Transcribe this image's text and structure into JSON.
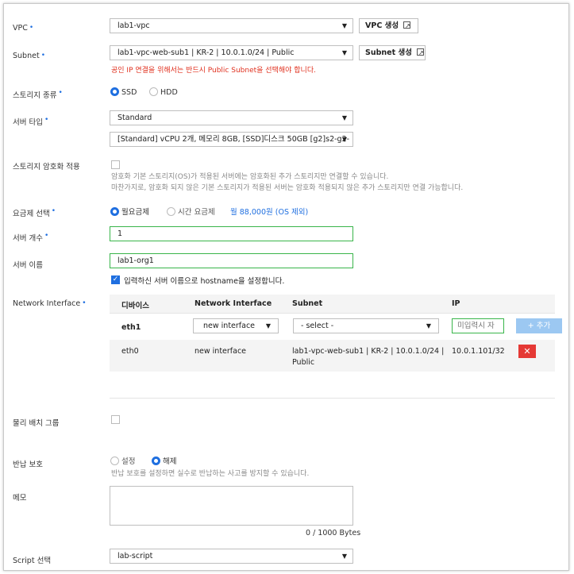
{
  "vpc": {
    "label": "VPC",
    "value": "lab1-vpc",
    "create_btn": "VPC 생성"
  },
  "subnet": {
    "label": "Subnet",
    "value": "lab1-vpc-web-sub1 | KR-2 | 10.0.1.0/24 | Public",
    "create_btn": "Subnet 생성",
    "warning": "공인 IP 연결을 위해서는 반드시 Public Subnet을 선택해야 합니다."
  },
  "storage_type": {
    "label": "스토리지 종류",
    "options": [
      "SSD",
      "HDD"
    ],
    "selected": "SSD"
  },
  "server_type": {
    "label": "서버 타입",
    "value": "Standard",
    "spec": "[Standard] vCPU 2개, 메모리 8GB, [SSD]디스크 50GB [g2]s2-g2-"
  },
  "storage_encryption": {
    "label": "스토리지 암호화 적용",
    "help1": "암호화 기본 스토리지(OS)가 적용된 서버에는 암호화된 추가 스토리지만 연결할 수 있습니다.",
    "help2": "마찬가지로, 암호화 되지 않은 기본 스토리지가 적용된 서버는 암호화 적용되지 않은 추가 스토리지만 연결 가능합니다."
  },
  "billing": {
    "label": "요금제 선택",
    "options": [
      "월요금제",
      "시간 요금제"
    ],
    "selected": "월요금제",
    "price": "월 88,000원 (OS 제외)"
  },
  "server_count": {
    "label": "서버 개수",
    "value": "1"
  },
  "server_name": {
    "label": "서버 이름",
    "value": "lab1-org1",
    "hostname_check": "입력하신 서버 이름으로 hostname을 설정합니다."
  },
  "network_interface": {
    "label": "Network Interface",
    "headers": [
      "디바이스",
      "Network Interface",
      "Subnet",
      "IP"
    ],
    "new_row": {
      "device": "eth1",
      "interface": "new interface",
      "subnet": "- select -",
      "ip_placeholder": "미입력시 자",
      "add_btn": "+ 추가"
    },
    "rows": [
      {
        "device": "eth0",
        "interface": "new interface",
        "subnet_line1": "lab1-vpc-web-sub1 | KR-2 | 10.0.1.0/24 |",
        "subnet_line2": "Public",
        "ip": "10.0.1.101/32",
        "delete_icon": "✕"
      }
    ]
  },
  "placement_group": {
    "label": "물리 배치 그룹"
  },
  "termination_protection": {
    "label": "반납 보호",
    "options": [
      "설정",
      "해제"
    ],
    "selected": "해제",
    "help": "반납 보호를 설정하면 실수로 반납하는 사고를 방지할 수 있습니다."
  },
  "memo": {
    "label": "메모",
    "counter": "0 / 1000 Bytes"
  },
  "script": {
    "label": "Script 선택",
    "value": "lab-script"
  },
  "colors": {
    "accent": "#1f6fe0",
    "valid_border": "#39b54a",
    "warning": "#e0301e",
    "delete": "#e53935",
    "add_btn": "#9cc8f2"
  }
}
